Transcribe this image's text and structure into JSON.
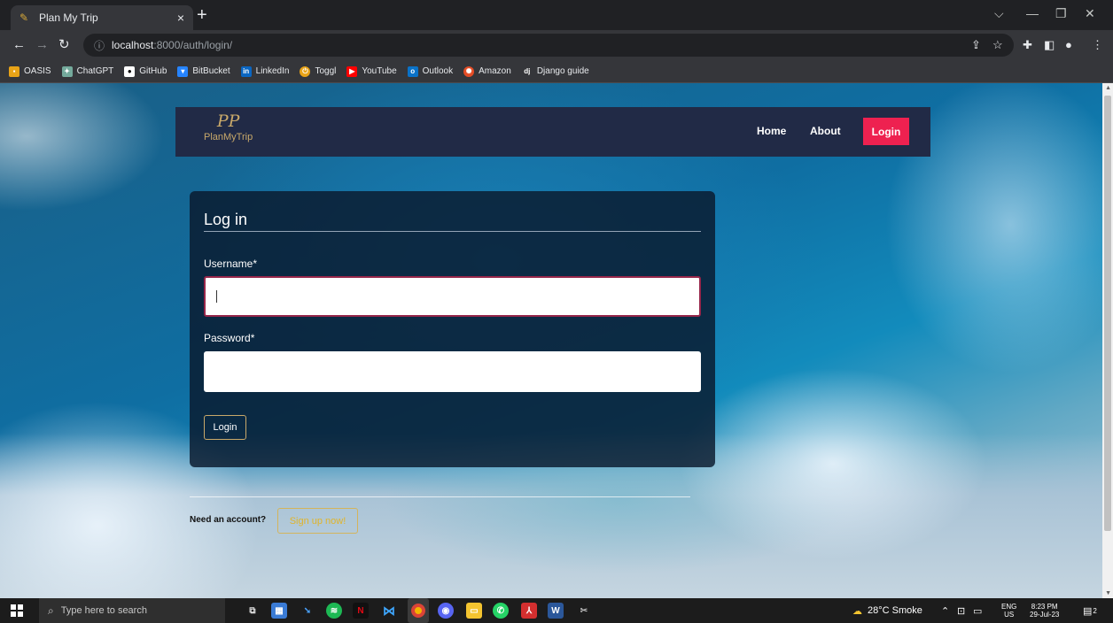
{
  "browser": {
    "tab_title": "Plan My Trip",
    "tab_close": "×",
    "new_tab": "+",
    "url_host": "localhost",
    "url_path": ":8000/auth/login/",
    "bookmarks": [
      {
        "label": "OASIS",
        "icon": "oasis-icon",
        "color": "#e8a317"
      },
      {
        "label": "ChatGPT",
        "icon": "chatgpt-icon",
        "color": "#74aa9c"
      },
      {
        "label": "GitHub",
        "icon": "github-icon",
        "color": "#ffffff"
      },
      {
        "label": "BitBucket",
        "icon": "bitbucket-icon",
        "color": "#2684ff"
      },
      {
        "label": "LinkedIn",
        "icon": "linkedin-icon",
        "color": "#0a66c2"
      },
      {
        "label": "Toggl",
        "icon": "toggl-icon",
        "color": "#e8a317"
      },
      {
        "label": "YouTube",
        "icon": "youtube-icon",
        "color": "#ff0000"
      },
      {
        "label": "Outlook",
        "icon": "outlook-icon",
        "color": "#0a72c8"
      },
      {
        "label": "Amazon",
        "icon": "amazon-icon",
        "color": "#e44d26"
      },
      {
        "label": "Django guide",
        "icon": "django-icon",
        "color": "#35363a"
      }
    ]
  },
  "site": {
    "brand_mark": "PP",
    "brand_name": "PlanMyTrip",
    "nav": {
      "home": "Home",
      "about": "About",
      "login": "Login"
    },
    "colors": {
      "navbar": "#212a46",
      "accent": "#ee2150",
      "gold": "#c9a96a"
    }
  },
  "login_form": {
    "title": "Log in",
    "username_label": "Username*",
    "username_value": "",
    "password_label": "Password*",
    "password_value": "",
    "submit_label": "Login"
  },
  "footer": {
    "need_account": "Need an account?",
    "signup_label": "Sign up now!"
  },
  "taskbar": {
    "search_placeholder": "Type here to search",
    "weather": "28°C  Smoke",
    "lang_top": "ENG",
    "lang_bottom": "US",
    "time": "8:23 PM",
    "date": "29-Jul-23",
    "notifications": "2"
  }
}
